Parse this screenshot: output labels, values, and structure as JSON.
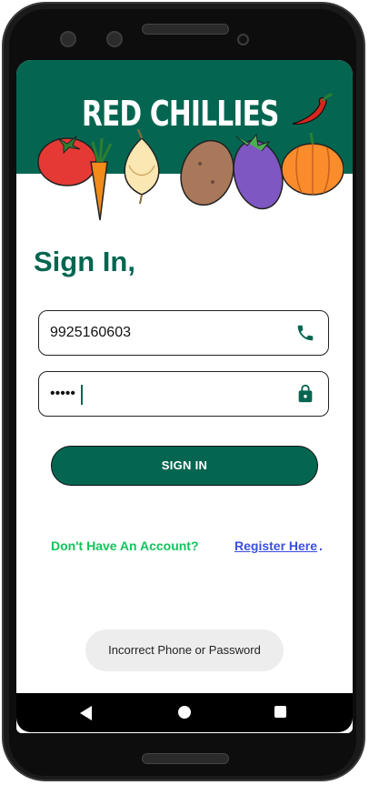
{
  "app": {
    "brand": "RED CHILLIES"
  },
  "signin": {
    "title": "Sign In,",
    "phone_value": "9925160603",
    "password_value": "•••••",
    "button_label": "SIGN IN"
  },
  "register": {
    "prompt": "Don't Have An Account?",
    "link_label": "Register Here",
    "period": "."
  },
  "toast": {
    "message": "Incorrect Phone or Password"
  },
  "icons": {
    "phone": "phone-icon",
    "lock": "lock-icon",
    "chili": "chili-pepper-icon"
  },
  "colors": {
    "primary": "#046650",
    "prompt_green": "#11c45c",
    "link_blue": "#3b4fe0"
  }
}
